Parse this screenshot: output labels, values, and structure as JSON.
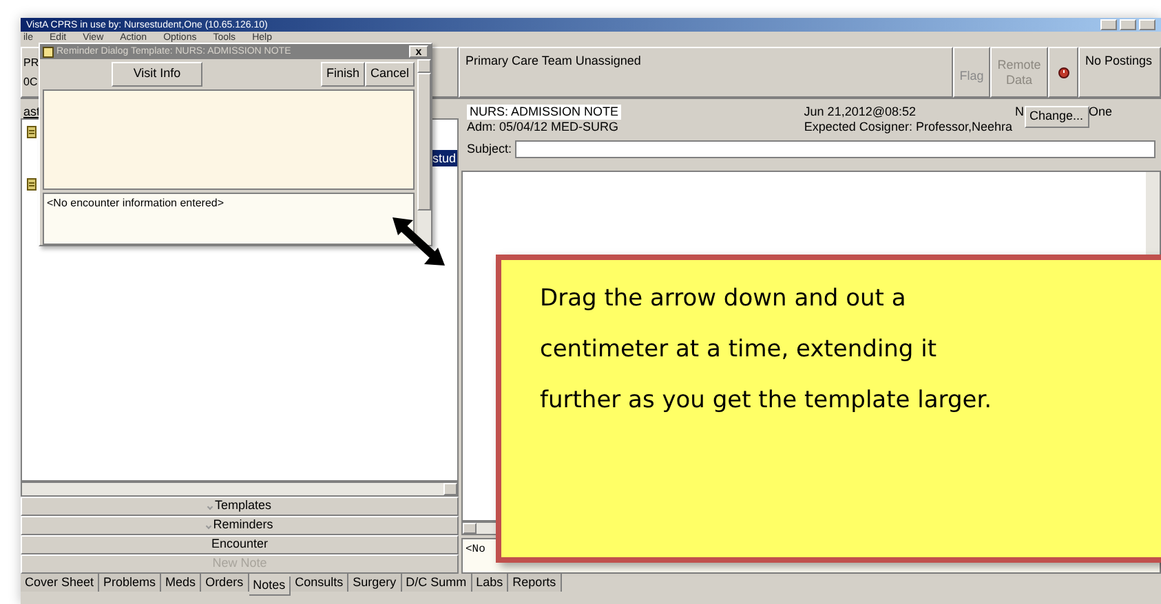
{
  "window": {
    "title": "VistA CPRS in use by: Nursestudent,One  (10.65.126.10)",
    "menu": [
      "ile",
      "Edit",
      "View",
      "Action",
      "Options",
      "Tools",
      "Help"
    ]
  },
  "patient_bar": {
    "patient_lines": [
      "PR",
      "0C"
    ],
    "team": "Primary Care Team Unassigned",
    "flag": {
      "label": "Flag",
      "disabled": true
    },
    "remote_data": {
      "label": "Remote Data",
      "disabled": true
    },
    "postings": "No Postings"
  },
  "left_pane": {
    "label": "ast",
    "items": [
      {
        "label": "stud",
        "selected": true
      }
    ],
    "buttons": [
      {
        "label": "Templates",
        "kind": "expander",
        "disabled": false
      },
      {
        "label": "Reminders",
        "kind": "expander",
        "disabled": false
      },
      {
        "label": "Encounter",
        "kind": "plain",
        "disabled": false
      },
      {
        "label": "New Note",
        "kind": "plain",
        "disabled": true
      }
    ]
  },
  "note": {
    "title": "NURS: ADMISSION NOTE",
    "admission": "Adm: 05/04/12  MED-SURG",
    "date": "Jun 21,2012@08:52",
    "author_start": "N",
    "author_end": "One",
    "change_button": "Change...",
    "cosigner": "Expected Cosigner: Professor,Neehra",
    "subject_label": "Subject:",
    "encounter": "<No"
  },
  "tabs": [
    {
      "label": "Cover Sheet",
      "selected": false
    },
    {
      "label": "Problems",
      "selected": false
    },
    {
      "label": "Meds",
      "selected": false
    },
    {
      "label": "Orders",
      "selected": false
    },
    {
      "label": "Notes",
      "selected": true
    },
    {
      "label": "Consults",
      "selected": false
    },
    {
      "label": "Surgery",
      "selected": false
    },
    {
      "label": "D/C Summ",
      "selected": false
    },
    {
      "label": "Labs",
      "selected": false
    },
    {
      "label": "Reports",
      "selected": false
    }
  ],
  "dialog": {
    "title": "Reminder Dialog Template: NURS: ADMISSION NOTE",
    "close": "x",
    "buttons": [
      "Visit Info",
      "Finish",
      "Cancel"
    ],
    "encounter": "<No encounter information entered>"
  },
  "callout": {
    "text": "Drag the arrow down and out a centimeter at a time, extending it further as you get the template larger."
  }
}
